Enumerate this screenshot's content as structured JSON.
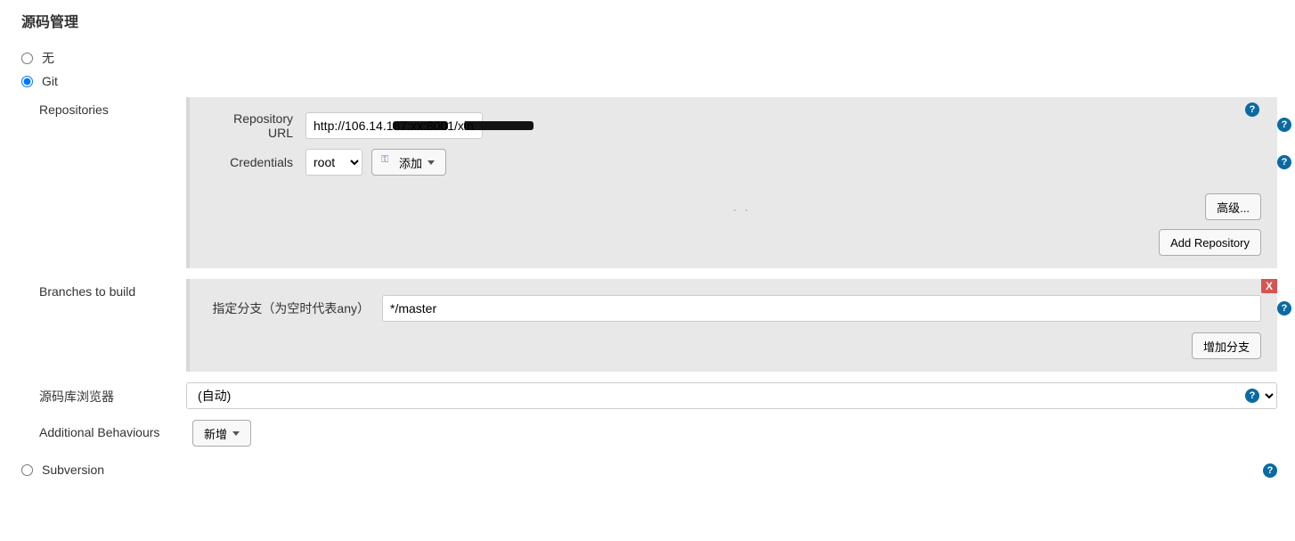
{
  "section_title": "源码管理",
  "scm": {
    "options": {
      "none_label": "无",
      "git_label": "Git",
      "subversion_label": "Subversion"
    },
    "selected": "git"
  },
  "repositories": {
    "label": "Repositories",
    "repo_url_label": "Repository URL",
    "repo_url_value": "http://106.14.187:xx:8001/xinxing-zhu/vuedemo.git",
    "credentials_label": "Credentials",
    "credentials_selected": "root",
    "add_credentials_label": "添加",
    "advanced_button": "高级...",
    "add_repo_button": "Add Repository"
  },
  "branches": {
    "label": "Branches to build",
    "branch_specifier_label": "指定分支（为空时代表any）",
    "branch_specifier_value": "*/master",
    "delete_x": "X",
    "add_branch_button": "增加分支"
  },
  "repo_browser": {
    "label": "源码库浏览器",
    "selected": "(自动)"
  },
  "additional_behaviours": {
    "label": "Additional Behaviours",
    "add_button": "新增"
  },
  "help_glyph": "?"
}
